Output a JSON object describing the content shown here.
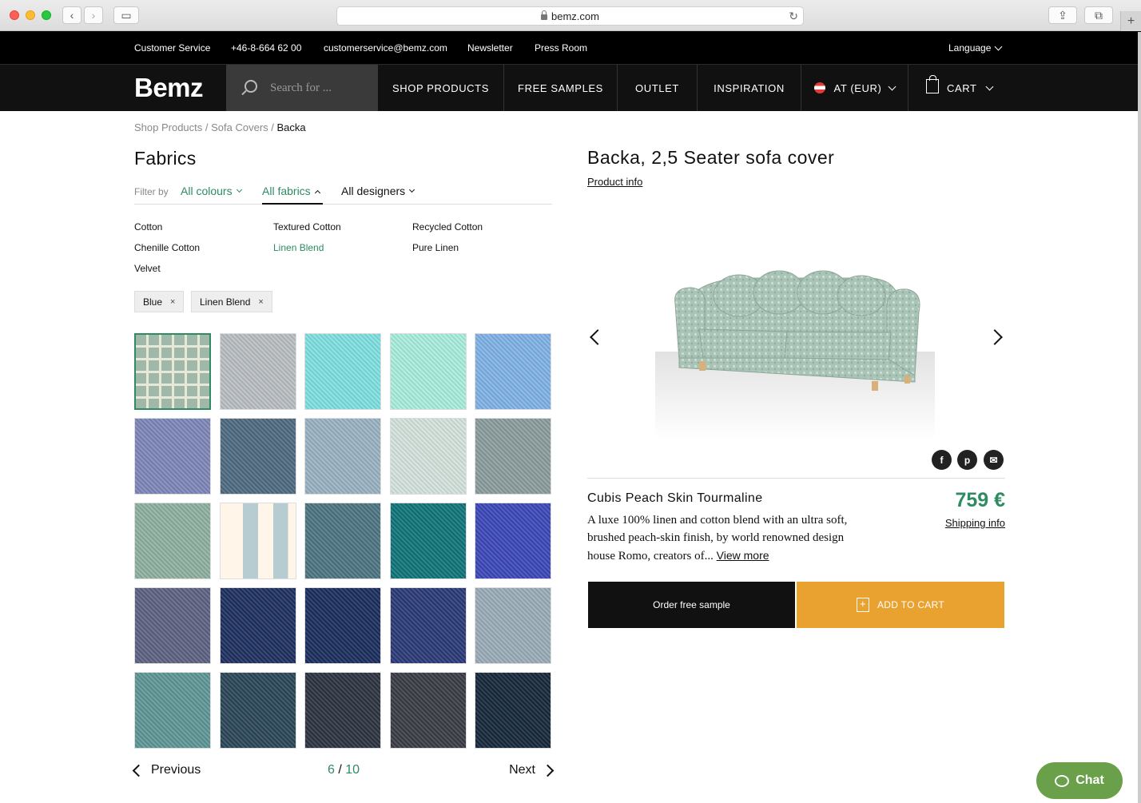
{
  "browser": {
    "url": "bemz.com"
  },
  "topbar": {
    "customer_service": "Customer Service",
    "phone": "+46-8-664 62 00",
    "email": "customerservice@bemz.com",
    "newsletter": "Newsletter",
    "press": "Press Room",
    "language": "Language"
  },
  "nav": {
    "logo": "Bemz",
    "search_placeholder": "Search for ...",
    "shop": "SHOP PRODUCTS",
    "samples": "FREE SAMPLES",
    "outlet": "OUTLET",
    "inspiration": "INSPIRATION",
    "region": "AT (EUR)",
    "cart": "CART"
  },
  "breadcrumb": {
    "a": "Shop Products",
    "sep1": " / ",
    "b": "Sofa Covers",
    "sep2": " / ",
    "c": "Backa"
  },
  "left": {
    "title": "Fabrics",
    "filter_label": "Filter by",
    "colours": "All colours",
    "fabrics": "All fabrics",
    "designers": "All designers",
    "fabric_options": [
      "Cotton",
      "Textured Cotton",
      "Recycled Cotton",
      "Chenille Cotton",
      "Linen Blend",
      "Pure Linen",
      "Velvet"
    ],
    "tags": [
      "Blue",
      "Linen Blend"
    ],
    "tag_remove": "×",
    "swatches": [
      "#9fb8a8",
      "#b9bec2",
      "#7fe0e0",
      "#a8eedd",
      "#7fb2e6",
      "#7d86b8",
      "#4f6a80",
      "#9ab2c2",
      "#d4e2dc",
      "#8b9c9c",
      "#8fb0a0",
      "#e8eee8",
      "#4d7582",
      "#0f7478",
      "#3c48b8",
      "#5d6282",
      "#1e3060",
      "#1a2e5c",
      "#2a3a78",
      "#9aacb8",
      "#5e9696",
      "#2a4658",
      "#2c3340",
      "#3a3c44",
      "#16283a"
    ],
    "pager": {
      "prev": "Previous",
      "current": "6",
      "sep": "/",
      "total": "10",
      "next": "Next"
    }
  },
  "right": {
    "title": "Backa, 2,5 Seater sofa cover",
    "product_info": "Product info",
    "share": {
      "facebook": "f",
      "pinterest": "p"
    },
    "fabric_name": "Cubis Peach Skin Tourmaline",
    "price": "759 €",
    "shipping": "Shipping info",
    "description": "A luxe 100% linen and cotton blend with an ultra soft, brushed peach-skin finish, by world renowned design house Romo, creators of...",
    "view_more": "View more",
    "order_sample": "Order free sample",
    "add_to_cart": "ADD TO CART"
  },
  "chat": {
    "label": "Chat"
  },
  "colors": {
    "accent_green": "#2e8b62",
    "cart_orange": "#e9a230",
    "chat_green": "#6aa04a"
  }
}
